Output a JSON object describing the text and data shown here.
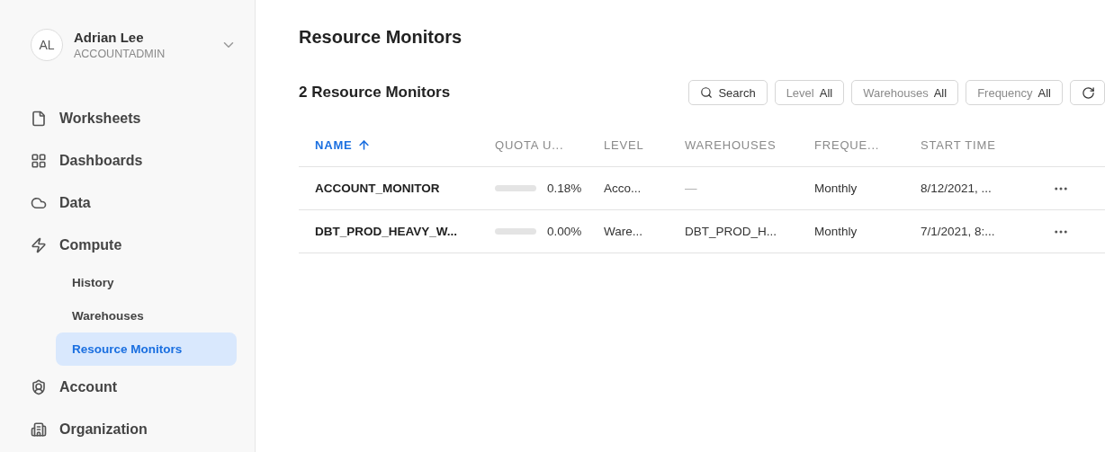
{
  "user": {
    "initials": "AL",
    "name": "Adrian Lee",
    "role": "ACCOUNTADMIN"
  },
  "nav": [
    {
      "kind": "top",
      "label": "Worksheets",
      "selected": false
    },
    {
      "kind": "top",
      "label": "Dashboards",
      "selected": false
    },
    {
      "kind": "top",
      "label": "Data",
      "selected": false
    },
    {
      "kind": "top",
      "label": "Compute",
      "selected": false
    },
    {
      "kind": "sub",
      "label": "History",
      "selected": false
    },
    {
      "kind": "sub",
      "label": "Warehouses",
      "selected": false
    },
    {
      "kind": "sub",
      "label": "Resource Monitors",
      "selected": true
    },
    {
      "kind": "top",
      "label": "Account",
      "selected": false
    },
    {
      "kind": "top",
      "label": "Organization",
      "selected": false
    }
  ],
  "page_title": "Resource Monitors",
  "count_heading": "2 Resource Monitors",
  "search": {
    "label": "Search"
  },
  "filters": [
    {
      "label": "Level",
      "value": "All"
    },
    {
      "label": "Warehouses",
      "value": "All"
    },
    {
      "label": "Frequency",
      "value": "All"
    }
  ],
  "table": {
    "columns": [
      {
        "label": "NAME",
        "sorted": true
      },
      {
        "label": "QUOTA U...",
        "sorted": false
      },
      {
        "label": "LEVEL",
        "sorted": false
      },
      {
        "label": "WAREHOUSES",
        "sorted": false
      },
      {
        "label": "FREQUE...",
        "sorted": false
      },
      {
        "label": "START TIME",
        "sorted": false
      }
    ],
    "rows": [
      {
        "name": "ACCOUNT_MONITOR",
        "quota": "0.18%",
        "monitor_level": "Acco...",
        "warehouses": "—",
        "frequency": "Monthly",
        "start_time": "8/12/2021, ..."
      },
      {
        "name": "DBT_PROD_HEAVY_W...",
        "quota": "0.00%",
        "monitor_level": "Ware...",
        "warehouses": "DBT_PROD_H...",
        "frequency": "Monthly",
        "start_time": "7/1/2021, 8:..."
      }
    ]
  }
}
